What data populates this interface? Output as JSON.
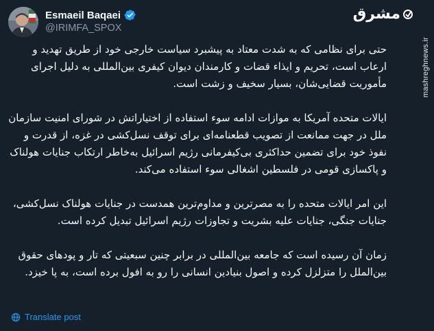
{
  "author": {
    "name": "Esmaeil Baqaei",
    "handle": "@IRIMFA_SPOX"
  },
  "brand": {
    "logo_text": "مشرق",
    "site_url": "mashreghnews.ir"
  },
  "tweet": {
    "paragraphs": [
      "حتی برای نظامی که به شدت معتاد به پیشبرد سیاست خارجی خود از طریق تهدید و ارعاب است، تحریم و ایذاء قضات و کارمندان دیوان کیفری بین‌المللی به دلیل اجرای مأموریت قضایی‌شان، بسیار سخیف و زشت است.",
      "ایالات متحده آمریکا به موازات ادامه سوء استفاده از اختیاراتش در شورای امنیت سازمان ملل در جهت ممانعت از تصویب قطعنامه‌ای برای توقف نسل‌کشی در غزه، از قدرت و نفوذ خود برای تضمین حداکثری بی‌کیفرمانی رژیم اسرائیل به‌خاطر ارتکاب جنایات هولناک و پاکسازی قومی در فلسطین اشغالی سوء استفاده می‌کند.",
      "این امر ایالات متحده را به مصرترین و مداوم‌ترین همدست در جنایات هولناک نسل‌کشی، جنایات جنگی، جنایات علیه بشریت و تجاوزات رژیم اسرائیل تبدیل کرده است.",
      "زمان آن رسیده است که جامعه بین‌المللی در برابر چنین سبعیتی که تار و پودهای حقوق بین‌الملل را متزلزل کرده و اصول بنیادین انسانی را رو به افول برده است، به پا خیزد."
    ]
  },
  "actions": {
    "translate_label": "Translate post"
  },
  "colors": {
    "background": "#15202b",
    "text": "#f7f9f9",
    "secondary_text": "#8b98a5",
    "accent": "#1d9bf0"
  },
  "icons": {
    "verified": "verified-badge-icon",
    "translate": "globe-icon",
    "brand": "mashregh-logo-icon"
  }
}
